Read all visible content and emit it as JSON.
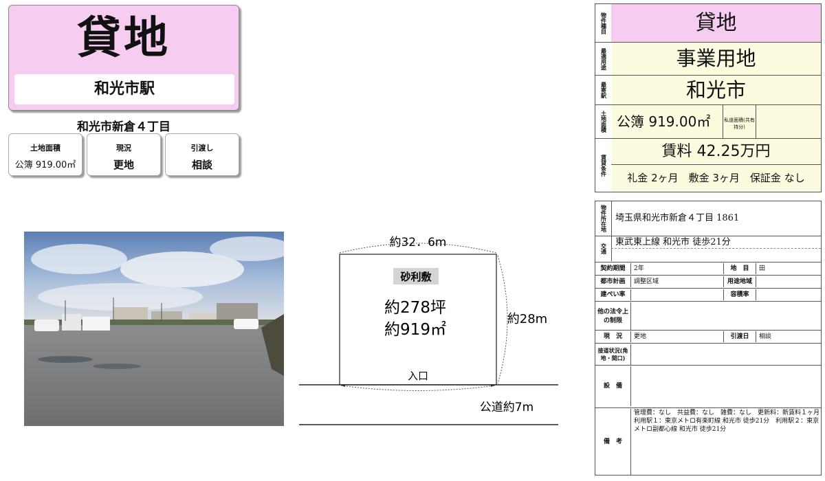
{
  "left": {
    "title": "貸地",
    "station": "和光市駅",
    "address": "和光市新倉４丁目",
    "cards": [
      {
        "label": "土地面積",
        "value": "公簿 919.00㎡"
      },
      {
        "label": "現況",
        "value": "更地"
      },
      {
        "label": "引渡し",
        "value": "相談"
      }
    ]
  },
  "diagram": {
    "top_width": "約32．6m",
    "surface": "砂利敷",
    "area_tsubo": "約278坪",
    "area_m2": "約919㎡",
    "right_length": "約28m",
    "entrance": "入口",
    "road": "公道約7m"
  },
  "summary": {
    "type_label": "物件種目",
    "type_value": "貸地",
    "use_label": "最適用途",
    "use_value": "事業用地",
    "station_label": "最寄駅",
    "station_value": "和光市",
    "area_label": "土地面積",
    "area_value": "公簿 919.00㎡",
    "private_road_label": "私道面積(共有持分)",
    "conditions_label": "賃貸条件",
    "rent": "賃料 42.25万円",
    "deposits": "礼金 2ヶ月　敷金 3ヶ月　保証金 なし"
  },
  "details": {
    "location_label": "物件所在地",
    "location_value": "埼玉県和光市新倉４丁目 1861",
    "transport_label": "交通",
    "transport_value": "東武東上線 和光市 徒歩21分",
    "rows": {
      "contract_label": "契約期間",
      "contract_value": "2年",
      "land_label": "地　目",
      "land_value": "田",
      "city_plan_label": "都市計画",
      "city_plan_value": "調整区域",
      "zoning_label": "用途地域",
      "coverage_label": "建ぺい率",
      "far_label": "容積率",
      "other_label": "他の法令上の制限",
      "status_label": "現　況",
      "status_value": "更地",
      "handover_label": "引渡日",
      "handover_value": "相談",
      "road_label": "接道状況(角地・間口)",
      "equip_label": "設　備",
      "notes_label": "備　考",
      "notes_value": "管理費：なし　共益費：なし　雑費：なし　更新料：新賃料１ヶ月　利用駅１：東京メトロ有楽町線 和光市 徒歩21分　利用駅２：東京メトロ副都心線 和光市 徒歩21分"
    }
  }
}
